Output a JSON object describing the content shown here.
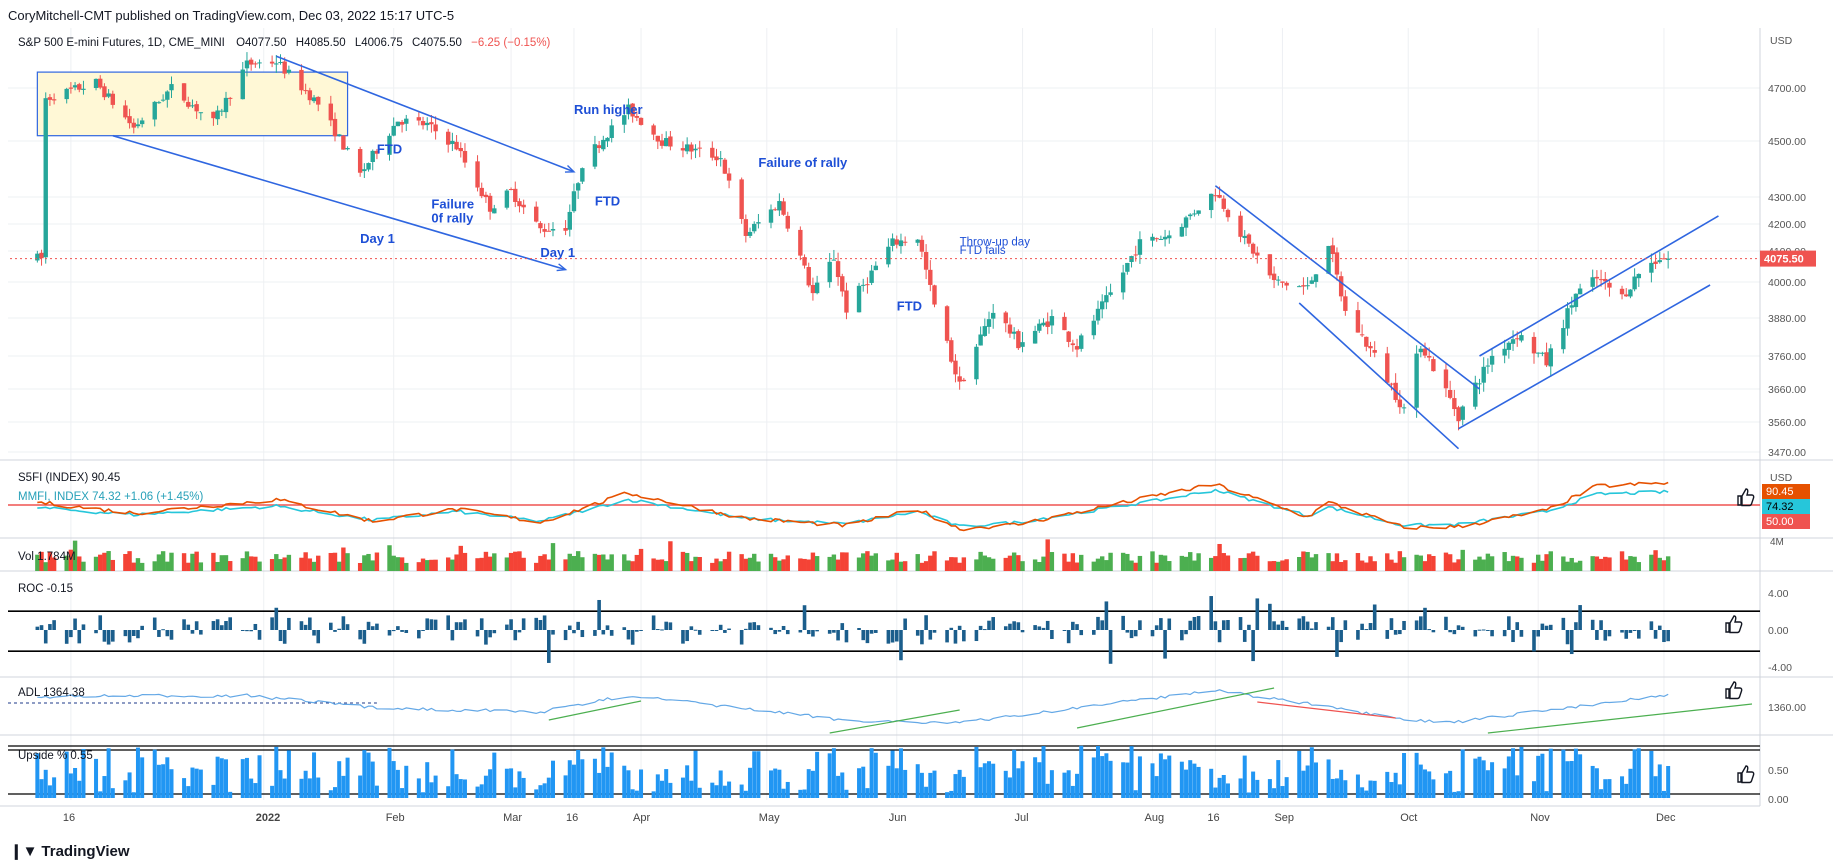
{
  "header": {
    "published_by": "CoryMitchell-CMT published on TradingView.com, Dec 03, 2022 15:17 UTC-5"
  },
  "footer": {
    "brand": "TradingView",
    "logo_icon": "tradingview-logo-icon"
  },
  "colors": {
    "up": "#26a69a",
    "down": "#ef5350",
    "annotation": "#1e4fd6",
    "trend_line": "#2f66e0",
    "roc": "#1b5e8c",
    "upside": "#2196f3",
    "s5fi": "#e65100",
    "mmfi": "#26c6da",
    "adl": "#64a8e6",
    "green_line": "#4caf50",
    "red_line": "#ef5350",
    "box_fill": "#fff8d6"
  },
  "chart_data": [
    {
      "type": "candlestick",
      "title": "S&P 500 E-mini Futures, 1D, CME_MINI",
      "ohlc_text": {
        "o": "O4077.50",
        "h": "H4085.50",
        "l": "L4006.75",
        "c": "C4075.50",
        "chg": "−6.25 (−0.15%)"
      },
      "currency": "USD",
      "y_ticks": [
        "4700.00",
        "4500.00",
        "4300.00",
        "4200.00",
        "4100.00",
        "4000.00",
        "3880.00",
        "3760.00",
        "3660.00",
        "3560.00",
        "3470.00"
      ],
      "last_price": "4075.50",
      "x_ticks": [
        "16",
        "2022",
        "Feb",
        "Mar",
        "16",
        "Apr",
        "May",
        "Jun",
        "Jul",
        "Aug",
        "16",
        "Sep",
        "Oct",
        "Nov",
        "Dec"
      ],
      "anchors": [
        [
          "2021-11-10",
          4660
        ],
        [
          "2021-11-22",
          4720
        ],
        [
          "2021-12-01",
          4550
        ],
        [
          "2021-12-10",
          4700
        ],
        [
          "2021-12-20",
          4570
        ],
        [
          "2021-12-28",
          4790
        ],
        [
          "2022-01-04",
          4800
        ],
        [
          "2022-01-14",
          4640
        ],
        [
          "2022-01-24",
          4380
        ],
        [
          "2022-02-02",
          4580
        ],
        [
          "2022-02-09",
          4560
        ],
        [
          "2022-02-16",
          4480
        ],
        [
          "2022-02-24",
          4260
        ],
        [
          "2022-03-01",
          4320
        ],
        [
          "2022-03-08",
          4180
        ],
        [
          "2022-03-14",
          4190
        ],
        [
          "2022-03-18",
          4420
        ],
        [
          "2022-03-29",
          4620
        ],
        [
          "2022-04-06",
          4500
        ],
        [
          "2022-04-20",
          4440
        ],
        [
          "2022-04-26",
          4160
        ],
        [
          "2022-05-04",
          4280
        ],
        [
          "2022-05-12",
          3960
        ],
        [
          "2022-05-17",
          4080
        ],
        [
          "2022-05-20",
          3910
        ],
        [
          "2022-05-31",
          4130
        ],
        [
          "2022-06-06",
          4150
        ],
        [
          "2022-06-10",
          3920
        ],
        [
          "2022-06-16",
          3670
        ],
        [
          "2022-06-24",
          3910
        ],
        [
          "2022-06-30",
          3800
        ],
        [
          "2022-07-08",
          3880
        ],
        [
          "2022-07-14",
          3790
        ],
        [
          "2022-07-22",
          3960
        ],
        [
          "2022-07-29",
          4130
        ],
        [
          "2022-08-05",
          4160
        ],
        [
          "2022-08-16",
          4320
        ],
        [
          "2022-08-23",
          4140
        ],
        [
          "2022-08-30",
          4000
        ],
        [
          "2022-09-07",
          3980
        ],
        [
          "2022-09-12",
          4130
        ],
        [
          "2022-09-16",
          3900
        ],
        [
          "2022-09-22",
          3780
        ],
        [
          "2022-09-30",
          3600
        ],
        [
          "2022-10-04",
          3800
        ],
        [
          "2022-10-13",
          3580
        ],
        [
          "2022-10-21",
          3760
        ],
        [
          "2022-10-27",
          3830
        ],
        [
          "2022-11-03",
          3740
        ],
        [
          "2022-11-10",
          3960
        ],
        [
          "2022-11-15",
          4010
        ],
        [
          "2022-11-21",
          3950
        ],
        [
          "2022-11-25",
          4030
        ],
        [
          "2022-11-30",
          4080
        ],
        [
          "2022-12-02",
          4075.5
        ]
      ],
      "annotations": [
        {
          "text": "FTD",
          "date": "2022-01-28",
          "price": 4455
        },
        {
          "text": "Failure",
          "date": "2022-02-10",
          "price": 4258
        },
        {
          "text": "0f rally",
          "date": "2022-02-10",
          "price": 4205
        },
        {
          "text": "Day 1",
          "date": "2022-01-24",
          "price": 4130
        },
        {
          "text": "Run higher",
          "date": "2022-03-16",
          "price": 4602
        },
        {
          "text": "FTD",
          "date": "2022-03-21",
          "price": 4268
        },
        {
          "text": "Day 1",
          "date": "2022-03-08",
          "price": 4080
        },
        {
          "text": "Failure of rally",
          "date": "2022-04-29",
          "price": 4407
        },
        {
          "text": "FTD",
          "date": "2022-06-01",
          "price": 3905
        },
        {
          "text": "Throw-up day",
          "date": "2022-06-16",
          "price": 4120
        },
        {
          "text": "FTD fails",
          "date": "2022-06-16",
          "price": 4090
        }
      ],
      "trendlines": [
        {
          "from": [
            "2022-01-04",
            4820
          ],
          "to": [
            "2022-03-16",
            4390
          ]
        },
        {
          "from": [
            "2021-11-26",
            4520
          ],
          "to": [
            "2022-03-14",
            4040
          ]
        },
        {
          "from": [
            "2022-08-16",
            4340
          ],
          "to": [
            "2022-10-18",
            3660
          ]
        },
        {
          "from": [
            "2022-09-05",
            3930
          ],
          "to": [
            "2022-10-13",
            3480
          ]
        },
        {
          "from": [
            "2022-10-18",
            3760
          ],
          "to": [
            "2022-12-14",
            4230
          ]
        },
        {
          "from": [
            "2022-10-13",
            3540
          ],
          "to": [
            "2022-12-12",
            3990
          ]
        }
      ],
      "range_box": {
        "from_date": "2021-11-08",
        "to_date": "2022-01-21",
        "high": 4760,
        "low": 4520
      }
    },
    {
      "type": "line",
      "legend": [
        "S5FI (INDEX)  90.45",
        "MMFI, INDEX  74.32  +1.06 (+1.45%)"
      ],
      "currency": "USD",
      "tags": [
        "90.45",
        "74.32",
        "50.00"
      ],
      "threshold": 50,
      "s5fi_anchors": [
        [
          "2021-11-08",
          55
        ],
        [
          "2021-12-01",
          35
        ],
        [
          "2022-01-04",
          60
        ],
        [
          "2022-01-27",
          20
        ],
        [
          "2022-02-16",
          42
        ],
        [
          "2022-03-08",
          18
        ],
        [
          "2022-03-29",
          72
        ],
        [
          "2022-04-26",
          25
        ],
        [
          "2022-05-20",
          12
        ],
        [
          "2022-06-06",
          42
        ],
        [
          "2022-06-16",
          6
        ],
        [
          "2022-06-30",
          14
        ],
        [
          "2022-08-05",
          72
        ],
        [
          "2022-08-16",
          88
        ],
        [
          "2022-09-07",
          28
        ],
        [
          "2022-09-12",
          55
        ],
        [
          "2022-09-30",
          8
        ],
        [
          "2022-10-13",
          10
        ],
        [
          "2022-11-03",
          40
        ],
        [
          "2022-11-15",
          85
        ],
        [
          "2022-12-02",
          90.45
        ]
      ],
      "mmfi_anchors": [
        [
          "2021-11-08",
          45
        ],
        [
          "2021-12-01",
          32
        ],
        [
          "2022-01-04",
          48
        ],
        [
          "2022-01-27",
          22
        ],
        [
          "2022-02-16",
          38
        ],
        [
          "2022-03-08",
          20
        ],
        [
          "2022-03-29",
          60
        ],
        [
          "2022-04-26",
          25
        ],
        [
          "2022-05-20",
          15
        ],
        [
          "2022-06-06",
          38
        ],
        [
          "2022-06-16",
          10
        ],
        [
          "2022-06-30",
          18
        ],
        [
          "2022-08-05",
          62
        ],
        [
          "2022-08-16",
          78
        ],
        [
          "2022-09-07",
          30
        ],
        [
          "2022-09-12",
          46
        ],
        [
          "2022-09-30",
          12
        ],
        [
          "2022-10-13",
          14
        ],
        [
          "2022-11-03",
          38
        ],
        [
          "2022-11-15",
          70
        ],
        [
          "2022-12-02",
          74.32
        ]
      ]
    },
    {
      "type": "bar",
      "legend": "Vol  1.784M",
      "axis_label": "4M"
    },
    {
      "type": "bar",
      "legend": "ROC  -0.15",
      "y_ticks": [
        "4.00",
        "0.00",
        "-4.00"
      ],
      "bands": [
        1.6,
        -1.8
      ]
    },
    {
      "type": "line",
      "legend": "ADL  1364.38",
      "y_tick": "1360.00",
      "red_segment": {
        "from": [
          "2022-08-26",
          1362
        ],
        "to": [
          "2022-09-28",
          1318
        ]
      }
    },
    {
      "type": "bar",
      "legend": "Upside %  0.55",
      "y_ticks": [
        "0.50",
        "0.00"
      ]
    }
  ]
}
